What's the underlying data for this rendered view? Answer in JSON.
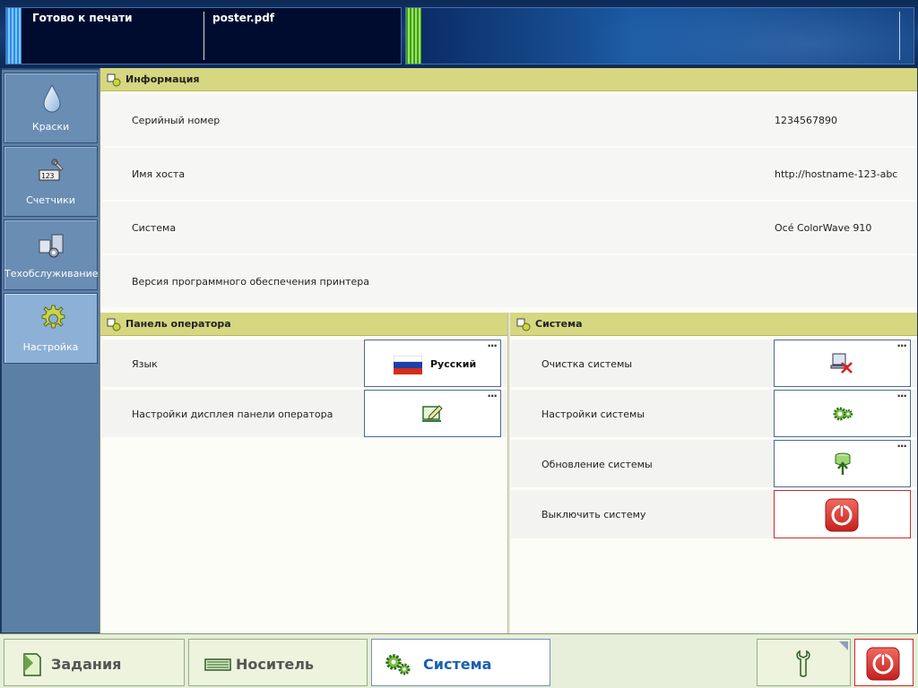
{
  "status": {
    "printer_state": "Готово к печати",
    "current_file": "poster.pdf"
  },
  "sidenav": {
    "items": [
      {
        "label": "Краски",
        "icon": "ink-drop-icon",
        "active": false
      },
      {
        "label": "Счетчики",
        "icon": "counters-icon",
        "active": false
      },
      {
        "label": "Техобслуживание",
        "icon": "maintenance-icon",
        "active": false
      },
      {
        "label": "Настройка",
        "icon": "settings-gear-icon",
        "active": true
      }
    ]
  },
  "info": {
    "title": "Информация",
    "rows": [
      {
        "label": "Серийный номер",
        "value": "1234567890"
      },
      {
        "label": "Имя хоста",
        "value": "http://hostname-123-abc"
      },
      {
        "label": "Система",
        "value": "Océ ColorWave 910"
      },
      {
        "label": "Версия программного обеспечения принтера",
        "value": ""
      }
    ]
  },
  "operator_panel": {
    "title": "Панель оператора",
    "rows": [
      {
        "label": "Язык",
        "button_text": "Русский",
        "icon": "russian-flag-icon"
      },
      {
        "label": "Настройки дисплея панели оператора",
        "button_text": "",
        "icon": "display-edit-icon"
      }
    ]
  },
  "system": {
    "title": "Система",
    "rows": [
      {
        "label": "Очистка системы",
        "icon": "system-clear-icon"
      },
      {
        "label": "Настройки системы",
        "icon": "system-settings-icon"
      },
      {
        "label": "Обновление системы",
        "icon": "system-update-icon"
      },
      {
        "label": "Выключить систему",
        "icon": "power-off-icon"
      }
    ]
  },
  "more_indicator": "...",
  "bottom_tabs": [
    {
      "label": "Задания",
      "icon": "jobs-icon",
      "active": false
    },
    {
      "label": "Носитель",
      "icon": "media-icon",
      "active": false
    },
    {
      "label": "Система",
      "icon": "system-gears-icon",
      "active": true
    }
  ],
  "colors": {
    "section_header": "#d6d780",
    "nav_bg": "#5c7fa6",
    "nav_active": "#8db0d6",
    "active_tab_text": "#1a5fb4",
    "power_red": "#d9292a"
  }
}
